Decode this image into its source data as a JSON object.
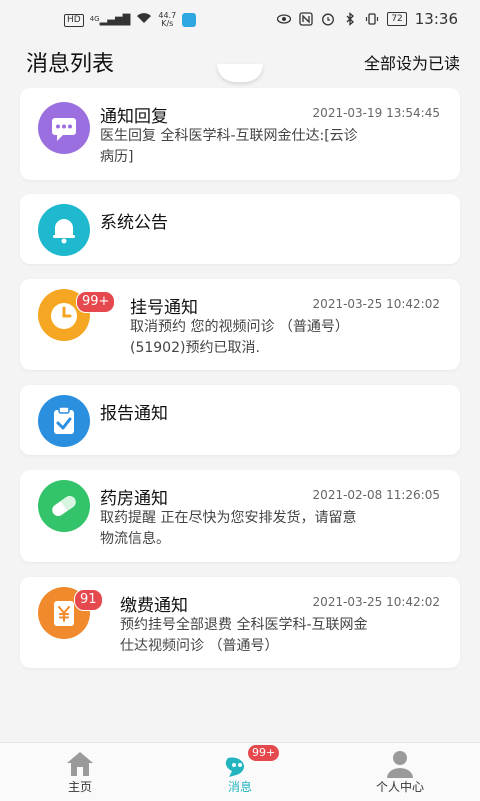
{
  "status_bar": {
    "network": "HD",
    "signal": "4G",
    "speed_value": "44.7",
    "speed_unit": "K/s",
    "battery": "72",
    "time": "13:36"
  },
  "header": {
    "title": "消息列表",
    "mark_all_read": "全部设为已读"
  },
  "messages": [
    {
      "title": "通知回复",
      "time": "2021-03-19 13:54:45",
      "body_lines": [
        "医生回复 全科医学科-互联网金仕达:[云诊",
        "病历]"
      ],
      "icon": "chat-bubble-icon",
      "color": "#9b6fe0",
      "badge": ""
    },
    {
      "title": "系统公告",
      "time": "",
      "body_lines": [],
      "icon": "bell-icon",
      "color": "#1fb9cf",
      "badge": ""
    },
    {
      "title": "挂号通知",
      "time": "2021-03-25 10:42:02",
      "body_lines": [
        "取消预约 您的视频问诊 （普通号）",
        "(51902)预约已取消."
      ],
      "icon": "clock-icon",
      "color": "#f5a623",
      "badge": "99+"
    },
    {
      "title": "报告通知",
      "time": "",
      "body_lines": [],
      "icon": "clipboard-check-icon",
      "color": "#2b8fe0",
      "badge": ""
    },
    {
      "title": "药房通知",
      "time": "2021-02-08 11:26:05",
      "body_lines": [
        "取药提醒 正在尽快为您安排发货，请留意",
        "物流信息。"
      ],
      "icon": "pill-icon",
      "color": "#33c36a",
      "badge": ""
    },
    {
      "title": "缴费通知",
      "time": "2021-03-25 10:42:02",
      "body_lines": [
        "预约挂号全部退费 全科医学科-互联网金",
        "仕达视频问诊 （普通号）"
      ],
      "icon": "yuan-bill-icon",
      "color": "#f08a2c",
      "badge": "91"
    }
  ],
  "tabbar": {
    "home": "主页",
    "messages": "消息",
    "messages_badge": "99+",
    "profile": "个人中心",
    "active_color": "#22b5bf"
  }
}
